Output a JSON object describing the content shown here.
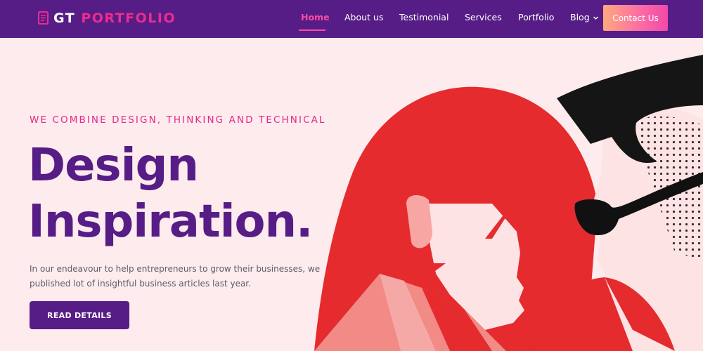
{
  "header": {
    "logo": {
      "icon": "document-icon",
      "text_main": "GT",
      "text_accent": "PORTFOLIO"
    },
    "nav": [
      {
        "label": "Home",
        "active": true
      },
      {
        "label": "About us"
      },
      {
        "label": "Testimonial"
      },
      {
        "label": "Services"
      },
      {
        "label": "Portfolio"
      },
      {
        "label": "Blog",
        "icon": "chevron-down-icon"
      }
    ],
    "cta": "Contact Us"
  },
  "hero": {
    "eyebrow": "WE COMBINE DESIGN, THINKING AND TECHNICAL",
    "headline_line1": "Design",
    "headline_line2": "Inspiration.",
    "description": "In our endeavour to help entrepreneurs to grow their businesses, we published lot of insightful business articles last year.",
    "button": "READ DETAILS"
  },
  "colors": {
    "header_bg": "#561d86",
    "accent_pink": "#ed2b8f",
    "page_bg": "#fdebed",
    "headline": "#561d86",
    "illustration_red": "#e52b2e"
  }
}
